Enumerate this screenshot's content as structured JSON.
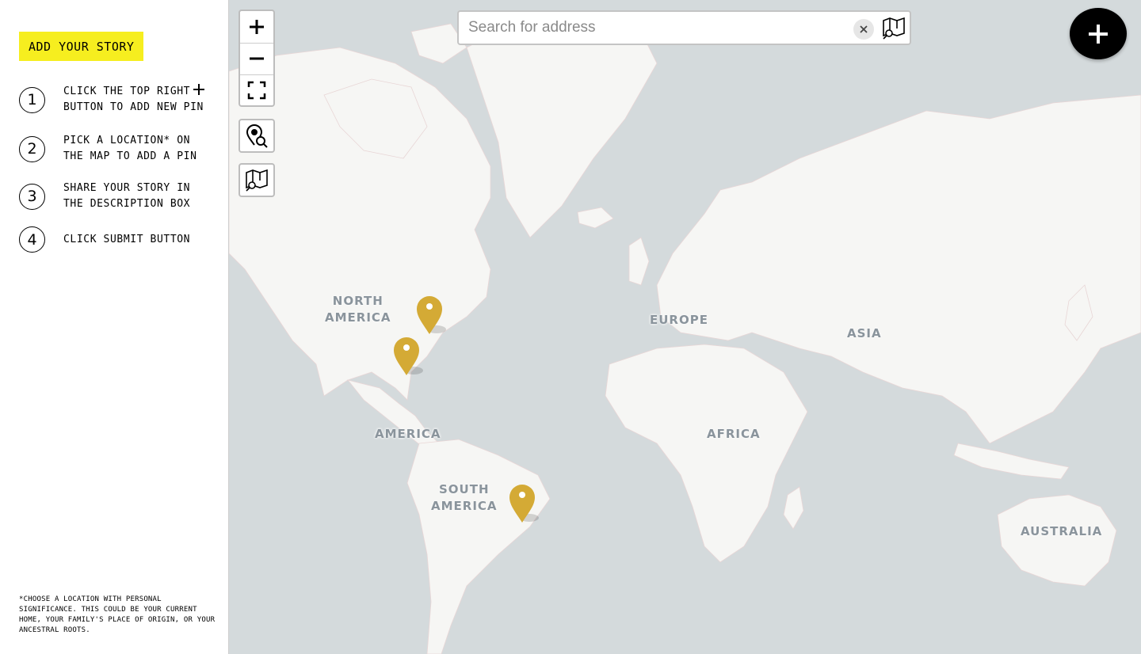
{
  "sidebar": {
    "title": "ADD YOUR STORY",
    "steps": [
      {
        "number": "1",
        "text": "CLICK THE TOP RIGHT",
        "text2": "BUTTON TO ADD NEW PIN"
      },
      {
        "number": "2",
        "text": "PICK A LOCATION* ON",
        "text2": "THE MAP TO ADD A PIN"
      },
      {
        "number": "3",
        "text": "SHARE YOUR STORY IN",
        "text2": "THE DESCRIPTION BOX"
      },
      {
        "number": "4",
        "text": "CLICK SUBMIT BUTTON",
        "text2": ""
      }
    ],
    "footnote": "*CHOOSE A LOCATION WITH PERSONAL SIGNIFICANCE. THIS COULD BE YOUR CURRENT HOME, YOUR FAMILY'S PLACE OF ORIGIN, OR YOUR ANCESTRAL ROOTS."
  },
  "map": {
    "search": {
      "placeholder": "Search for address"
    },
    "labels": {
      "north_america_1": "NORTH",
      "north_america_2": "AMERICA",
      "central_america": "AMERICA",
      "south_america_1": "SOUTH",
      "south_america_2": "AMERICA",
      "europe": "EUROPE",
      "asia": "ASIA",
      "africa": "AFRICA",
      "australia": "AUSTRALIA"
    },
    "pin_color": "#d4aa35",
    "controls": [
      "zoom-in-icon",
      "zoom-out-icon",
      "fullscreen-icon",
      "locate-search-icon",
      "map-search-icon"
    ],
    "colors": {
      "water": "#d4dadc",
      "land": "#f6f6f4",
      "accent": "#f6ee1f"
    }
  }
}
